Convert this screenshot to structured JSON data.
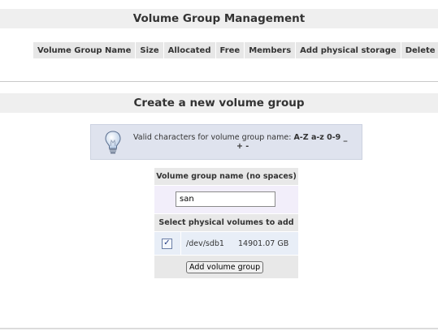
{
  "vg_management": {
    "title": "Volume Group Management",
    "columns": [
      "Volume Group Name",
      "Size",
      "Allocated",
      "Free",
      "Members",
      "Add physical storage",
      "Delete VG"
    ]
  },
  "create_vg": {
    "title": "Create a new volume group",
    "info_prefix": "Valid characters for volume group name: ",
    "info_chars": "A-Z a-z 0-9 _",
    "info_tail": "+ -",
    "name_label": "Volume group name (no spaces)",
    "name_value": "san",
    "pv_label": "Select physical volumes to add",
    "pv_checked": true,
    "pv_device": "/dev/sdb1",
    "pv_size": "14901.07 GB",
    "submit_label": "Add volume group"
  },
  "colors": {
    "header_bg": "#efefef",
    "info_bg": "#dfe3ee",
    "input_row_bg": "#f2eefa"
  },
  "icons": {
    "info": "lightbulb-icon"
  }
}
